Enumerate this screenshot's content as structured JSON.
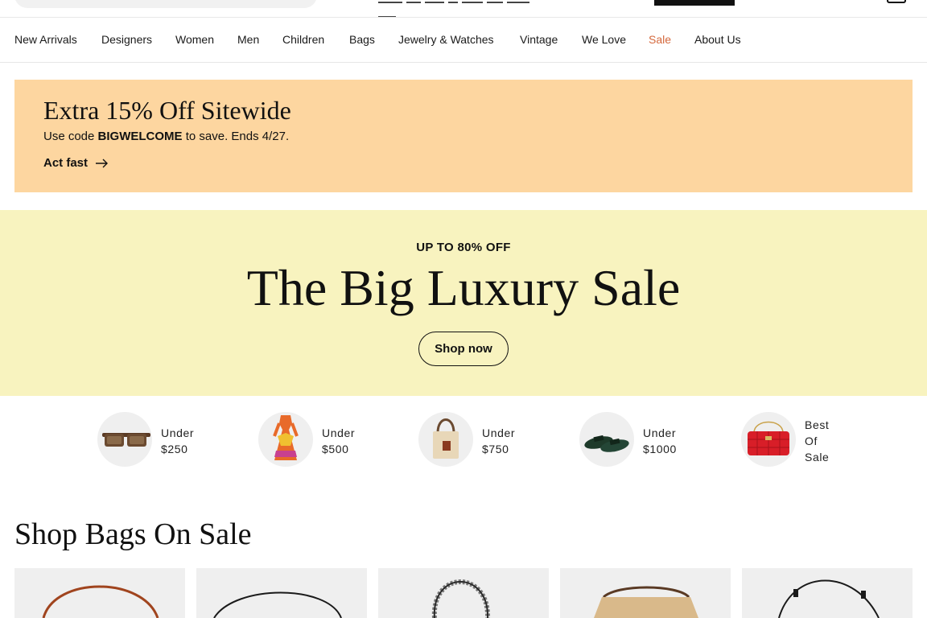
{
  "nav": {
    "items": [
      {
        "label": "New Arrivals",
        "name": "nav-new-arrivals"
      },
      {
        "label": "Designers",
        "name": "nav-designers"
      },
      {
        "label": "Women",
        "name": "nav-women"
      },
      {
        "label": "Men",
        "name": "nav-men"
      },
      {
        "label": "Children",
        "name": "nav-children"
      },
      {
        "label": "Bags",
        "name": "nav-bags"
      },
      {
        "label": "Jewelry & Watches",
        "name": "nav-jewelry-watches"
      },
      {
        "label": "Vintage",
        "name": "nav-vintage"
      },
      {
        "label": "We Love",
        "name": "nav-we-love"
      },
      {
        "label": "Sale",
        "name": "nav-sale"
      },
      {
        "label": "About Us",
        "name": "nav-about-us"
      }
    ],
    "sale_color": "#d4683c"
  },
  "promo": {
    "title": "Extra 15% Off Sitewide",
    "sub_prefix": "Use code ",
    "code": "BIGWELCOME",
    "sub_suffix": " to save. Ends 4/27.",
    "link_label": "Act fast",
    "link_icon": "arrow-right-icon",
    "background": "#fdd6a0"
  },
  "hero": {
    "eyebrow": "UP TO 80% OFF",
    "title": "The Big Luxury Sale",
    "button_label": "Shop now",
    "background": "#f8f3bf"
  },
  "price_tiles": [
    {
      "lines": [
        "Under",
        "$250"
      ],
      "icon": "sunglasses-icon"
    },
    {
      "lines": [
        "Under",
        "$500"
      ],
      "icon": "dress-icon"
    },
    {
      "lines": [
        "Under",
        "$750"
      ],
      "icon": "tote-bag-icon"
    },
    {
      "lines": [
        "Under",
        "$1000"
      ],
      "icon": "sandals-icon"
    },
    {
      "lines": [
        "Best",
        "Of",
        "Sale"
      ],
      "icon": "quilted-bag-icon"
    }
  ],
  "section": {
    "title": "Shop Bags On Sale"
  },
  "products": [
    {
      "icon": "brown-bag-icon"
    },
    {
      "icon": "black-bag-icon"
    },
    {
      "icon": "python-bag-icon"
    },
    {
      "icon": "raffia-bag-icon"
    },
    {
      "icon": "black-shoulder-bag-icon"
    }
  ]
}
